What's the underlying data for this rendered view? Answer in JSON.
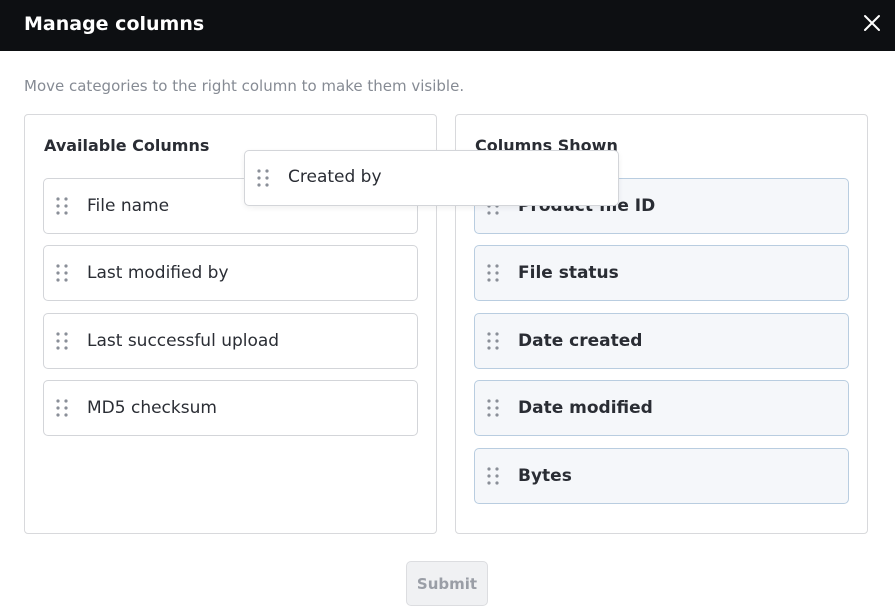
{
  "dialog": {
    "title": "Manage columns",
    "instructions": "Move categories to the right column to make them visible.",
    "submit_label": "Submit",
    "icons": {
      "close": "close-icon",
      "drag": "drag-handle-icon"
    }
  },
  "available": {
    "title": "Available Columns",
    "items": [
      {
        "label": "File name"
      },
      {
        "label": "Last modified by"
      },
      {
        "label": "Last successful upload"
      },
      {
        "label": "MD5 checksum"
      }
    ]
  },
  "shown": {
    "title": "Columns Shown",
    "items": [
      {
        "label": "Product file ID"
      },
      {
        "label": "File status"
      },
      {
        "label": "Date created"
      },
      {
        "label": "Date modified"
      },
      {
        "label": "Bytes"
      }
    ]
  },
  "dragging": {
    "label": "Created by"
  },
  "colors": {
    "header_bg": "#0d0f12",
    "shown_item_bg": "#f5f7fa",
    "shown_item_border": "#b9cde0",
    "muted_text": "#868b94"
  }
}
